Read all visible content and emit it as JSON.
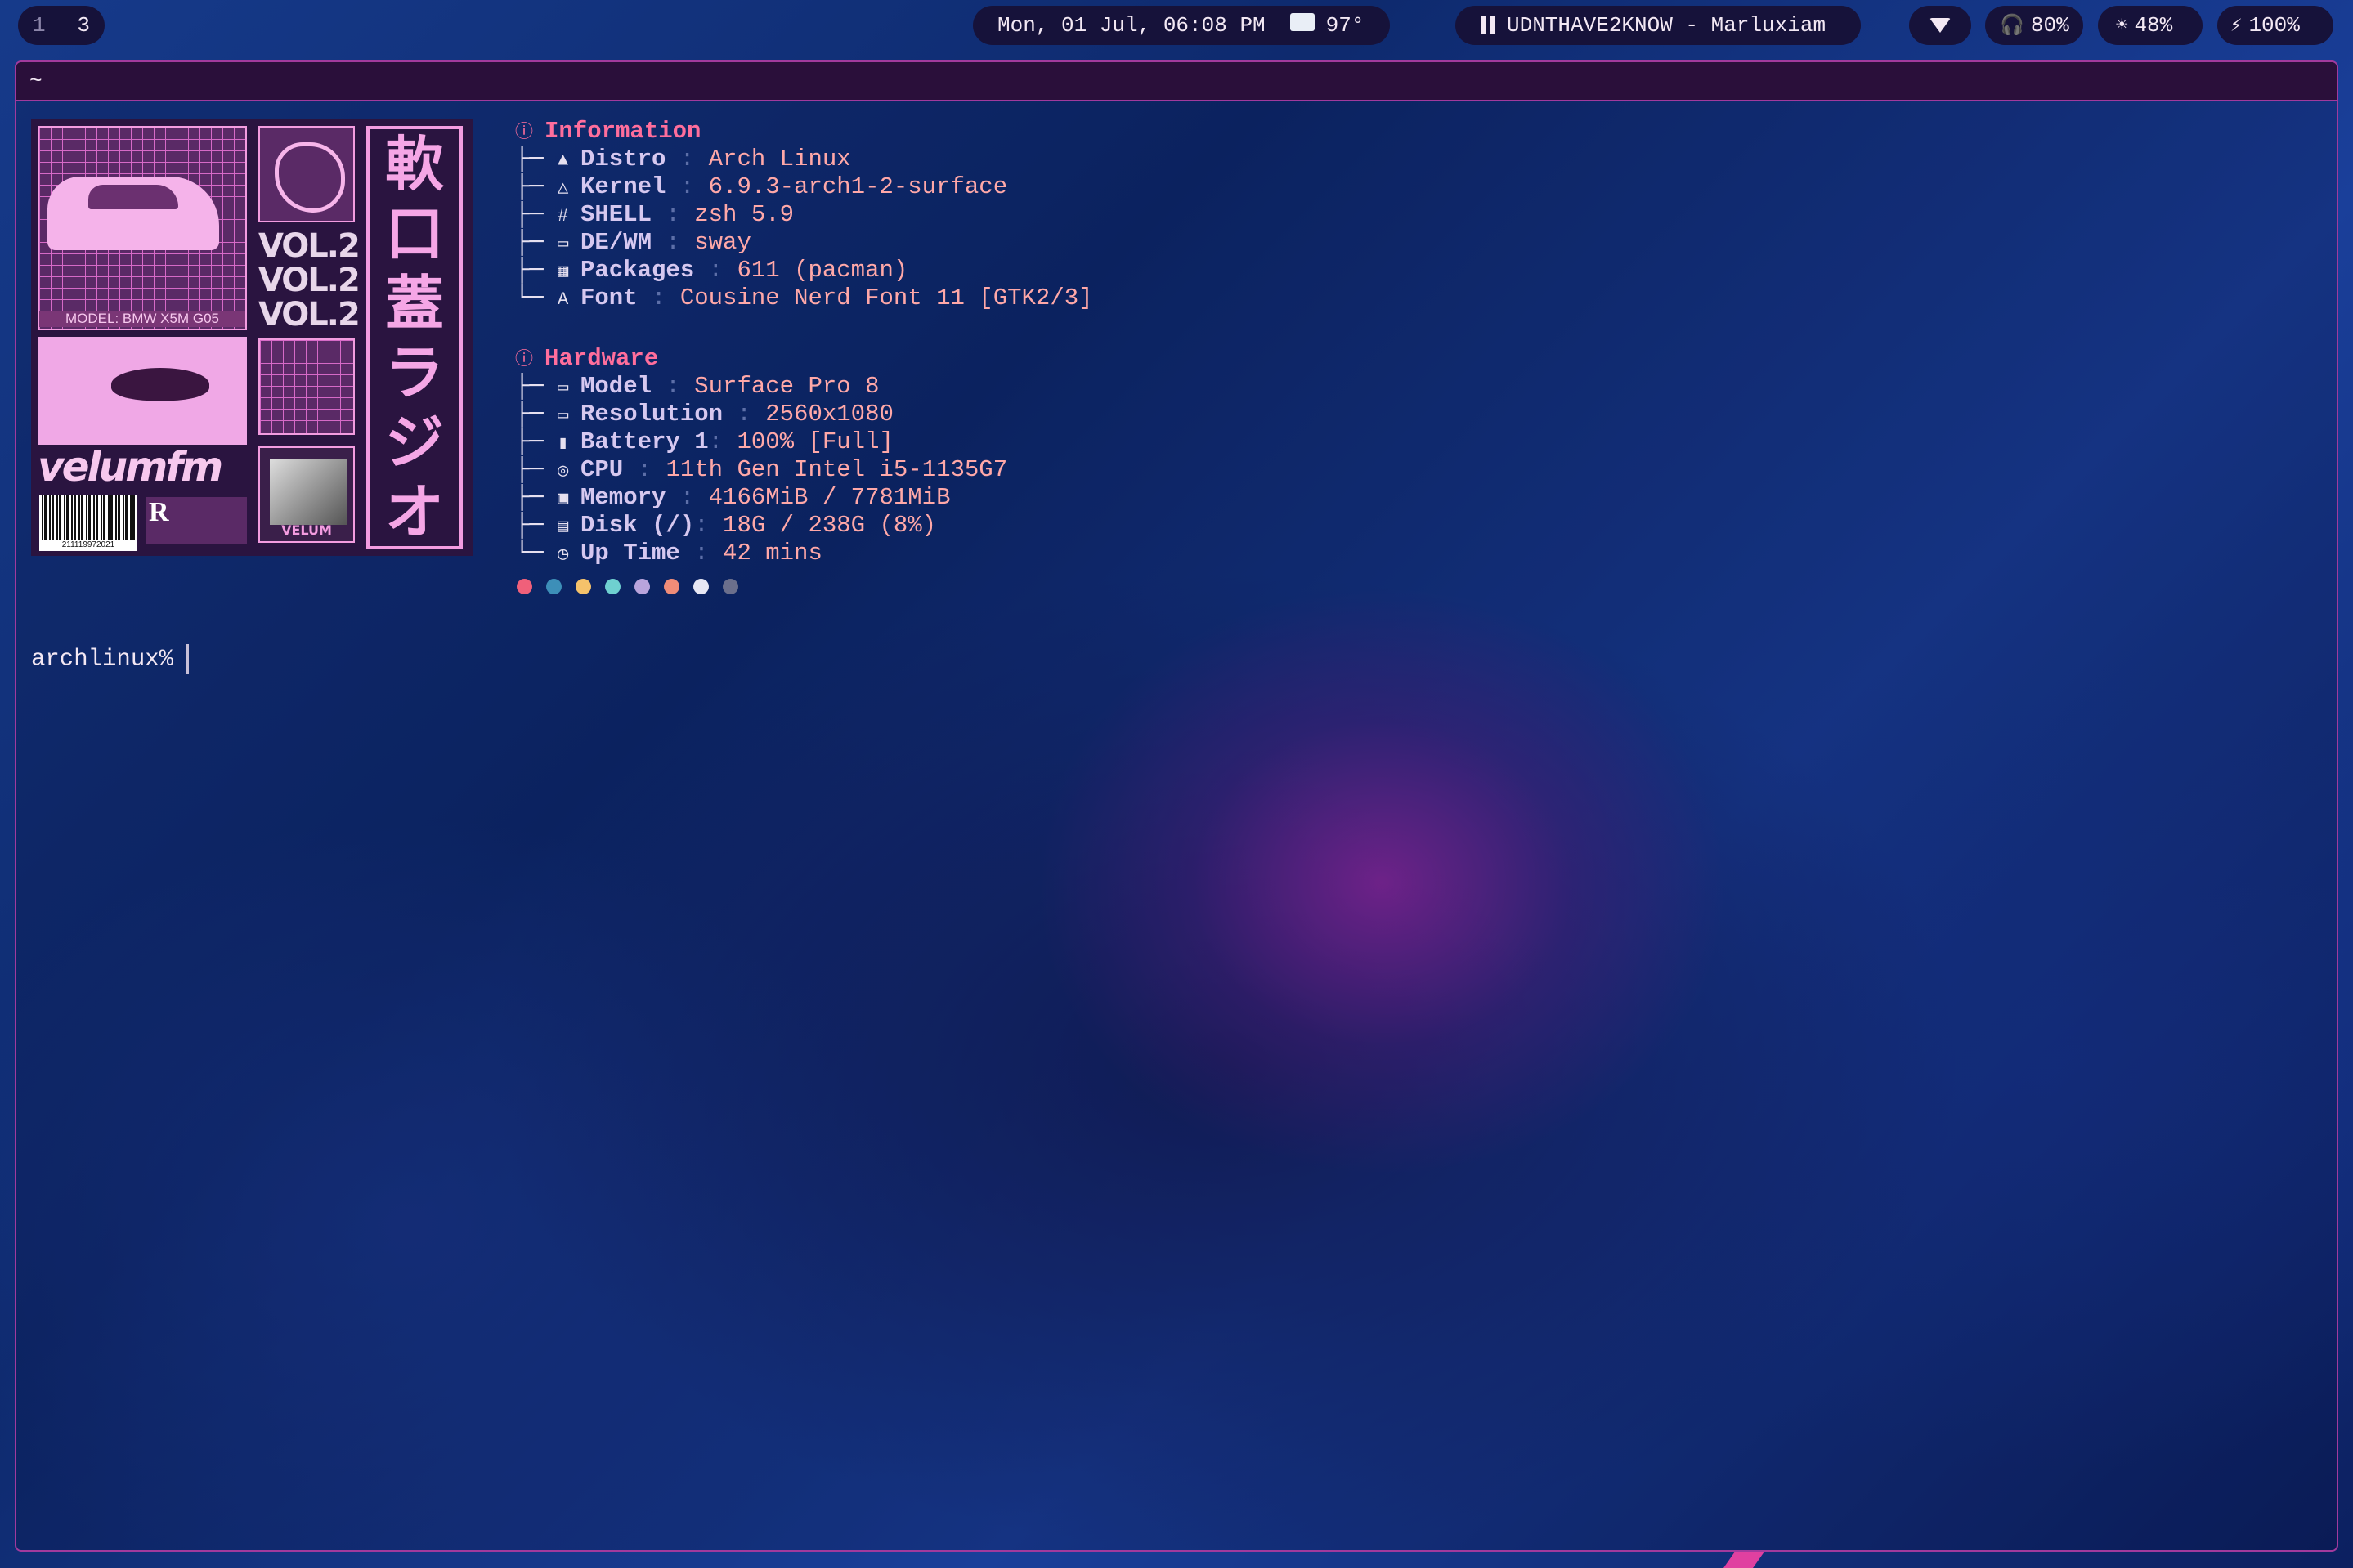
{
  "bar": {
    "workspaces": [
      "1",
      "3"
    ],
    "datetime": "Mon, 01 Jul, 06:08 PM",
    "weather_icon": "cloudy-icon",
    "temperature": "97°",
    "media_icon": "pause-icon",
    "now_playing": "UDNTHAVE2KNOW - Marluxiam",
    "wifi_icon": "wifi-icon",
    "volume": "80%",
    "brightness": "48%",
    "battery": "100%"
  },
  "terminal": {
    "title": "~",
    "art": {
      "car_label": "MODEL: BMW X5M G05",
      "vol_text": "VOL.2",
      "kanji": [
        "軟",
        "口",
        "蓋",
        "ラ",
        "ジ",
        "オ"
      ],
      "logo_text": "velumfm",
      "barcode_number": "211119972021",
      "r_letter": "R",
      "photo_label": "VELUM"
    },
    "fetch": {
      "information_title": "Information",
      "information": [
        {
          "icon": "arch-icon",
          "key": "Distro",
          "sep": " : ",
          "value": "Arch Linux"
        },
        {
          "icon": "linux-icon",
          "key": "Kernel",
          "sep": " : ",
          "value": "6.9.3-arch1-2-surface"
        },
        {
          "icon": "hash-icon",
          "key": "SHELL",
          "sep": " : ",
          "value": "zsh 5.9"
        },
        {
          "icon": "window-icon",
          "key": "DE/WM",
          "sep": " : ",
          "value": "sway"
        },
        {
          "icon": "package-icon",
          "key": "Packages",
          "sep": " : ",
          "value": "611 (pacman)"
        },
        {
          "icon": "font-icon",
          "key": "Font",
          "sep": " : ",
          "value": "Cousine Nerd Font 11 [GTK2/3]"
        }
      ],
      "hardware_title": "Hardware",
      "hardware": [
        {
          "icon": "laptop-icon",
          "key": "Model",
          "sep": " : ",
          "value": "Surface Pro 8"
        },
        {
          "icon": "monitor-icon",
          "key": "Resolution",
          "sep": " : ",
          "value": "2560x1080"
        },
        {
          "icon": "battery-icon",
          "key": "Battery 1",
          "sep": ": ",
          "value": "100% [Full]"
        },
        {
          "icon": "cpu-icon",
          "key": "CPU",
          "sep": " : ",
          "value": "11th Gen Intel i5-1135G7"
        },
        {
          "icon": "memory-icon",
          "key": "Memory",
          "sep": " : ",
          "value": "4166MiB / 7781MiB"
        },
        {
          "icon": "disk-icon",
          "key": "Disk (/)",
          "sep": ": ",
          "value": "18G / 238G (8%)"
        },
        {
          "icon": "clock-icon",
          "key": "Up Time",
          "sep": " : ",
          "value": "42 mins"
        }
      ],
      "palette": [
        "#f0607a",
        "#3d8fb8",
        "#f5c26b",
        "#6fd0d0",
        "#b9a4dc",
        "#f08c78",
        "#e8e8f4",
        "#6b6f8c"
      ]
    },
    "prompt": "archlinux%"
  }
}
